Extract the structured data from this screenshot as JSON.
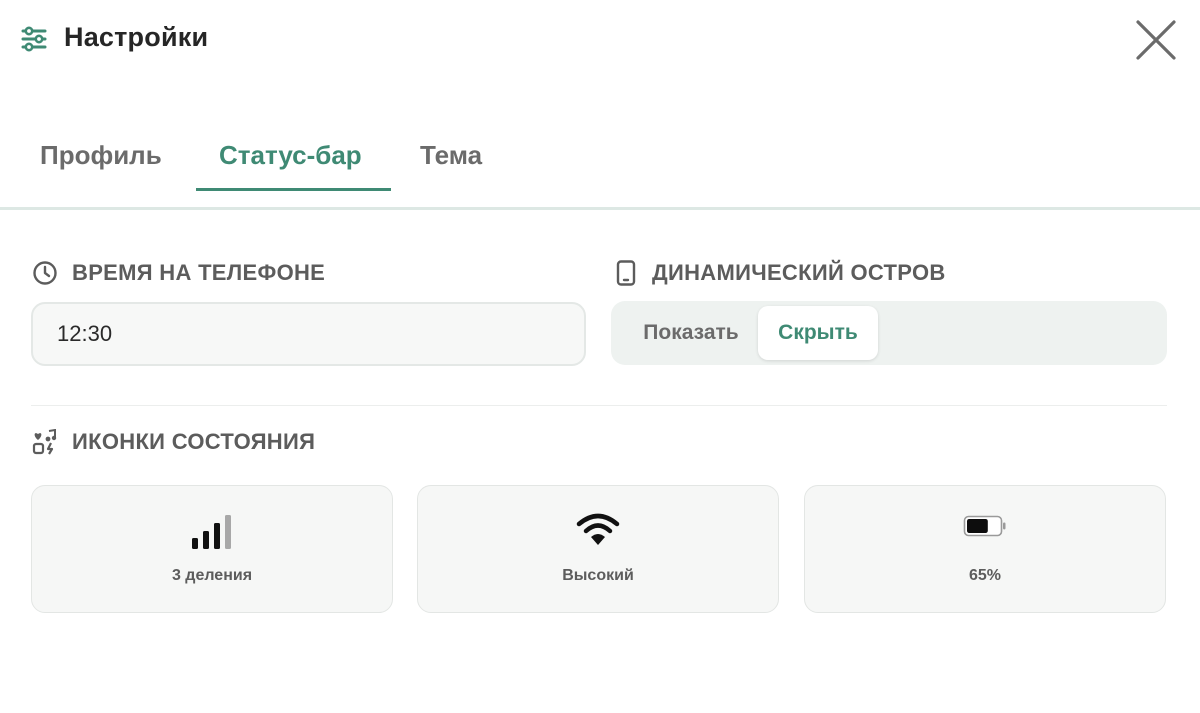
{
  "header": {
    "title": "Настройки",
    "settings_icon": "sliders-icon",
    "close_icon": "close-icon"
  },
  "tabs": [
    {
      "label": "Профиль",
      "active": false
    },
    {
      "label": "Статус-бар",
      "active": true
    },
    {
      "label": "Тема",
      "active": false
    }
  ],
  "time_section": {
    "label": "ВРЕМЯ НА ТЕЛЕФОНЕ",
    "icon": "clock-icon",
    "value": "12:30"
  },
  "island_section": {
    "label": "ДИНАМИЧЕСКИЙ ОСТРОВ",
    "icon": "phone-icon",
    "options": [
      "Показать",
      "Скрыть"
    ],
    "selected": "Скрыть"
  },
  "icons_section": {
    "label": "ИКОНКИ СОСТОЯНИЯ",
    "icon": "status-icons-icon",
    "cards": [
      {
        "icon": "cellular-signal-icon",
        "label": "3 деления",
        "bars_active": 3,
        "bars_total": 4
      },
      {
        "icon": "wifi-icon",
        "label": "Высокий"
      },
      {
        "icon": "battery-icon",
        "label": "65%",
        "level": 0.65
      }
    ]
  },
  "colors": {
    "accent": "#3f8a74",
    "muted_text": "#6b6b6b",
    "card_bg": "#f6f7f6",
    "segment_bg": "#eef2f0"
  }
}
